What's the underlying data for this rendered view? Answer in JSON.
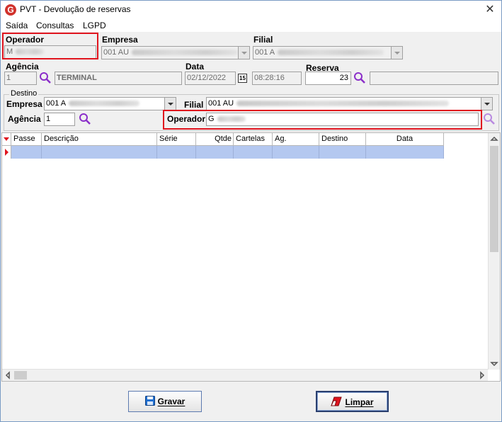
{
  "window": {
    "title": "PVT - Devolução de reservas",
    "logo_letter": "G"
  },
  "menu": [
    "Saída",
    "Consultas",
    "LGPD"
  ],
  "header": {
    "operador_label": "Operador",
    "operador_value": "M",
    "empresa_label": "Empresa",
    "empresa_value": "001 AU",
    "filial_label": "Filial",
    "filial_value": "001 A",
    "agencia_label": "Agência",
    "agencia_value": "1",
    "agencia_name": "TERMINAL",
    "data_label": "Data",
    "data_value": "02/12/2022",
    "calendar_glyph": "15",
    "time_value": "08:28:16",
    "reserva_label": "Reserva",
    "reserva_value": "23",
    "reserva_extra": ""
  },
  "destino": {
    "group_label": "Destino",
    "empresa_label": "Empresa",
    "empresa_value": "001 A",
    "filial_label": "Filial",
    "filial_value": "001 AU",
    "agencia_label": "Agência",
    "agencia_value": "1",
    "operador_label": "Operador",
    "operador_value": "G"
  },
  "grid": {
    "columns": [
      "Passe",
      "Descrição",
      "Série",
      "Qtde",
      "Cartelas",
      "Ag.",
      "Destino",
      "Data"
    ],
    "rows": []
  },
  "buttons": {
    "save_label": "Gravar",
    "clear_label": "Limpar"
  },
  "colors": {
    "highlight_box": "#e0141e",
    "selected_row": "#b4c8f0",
    "accent": "#8b2fc9"
  }
}
